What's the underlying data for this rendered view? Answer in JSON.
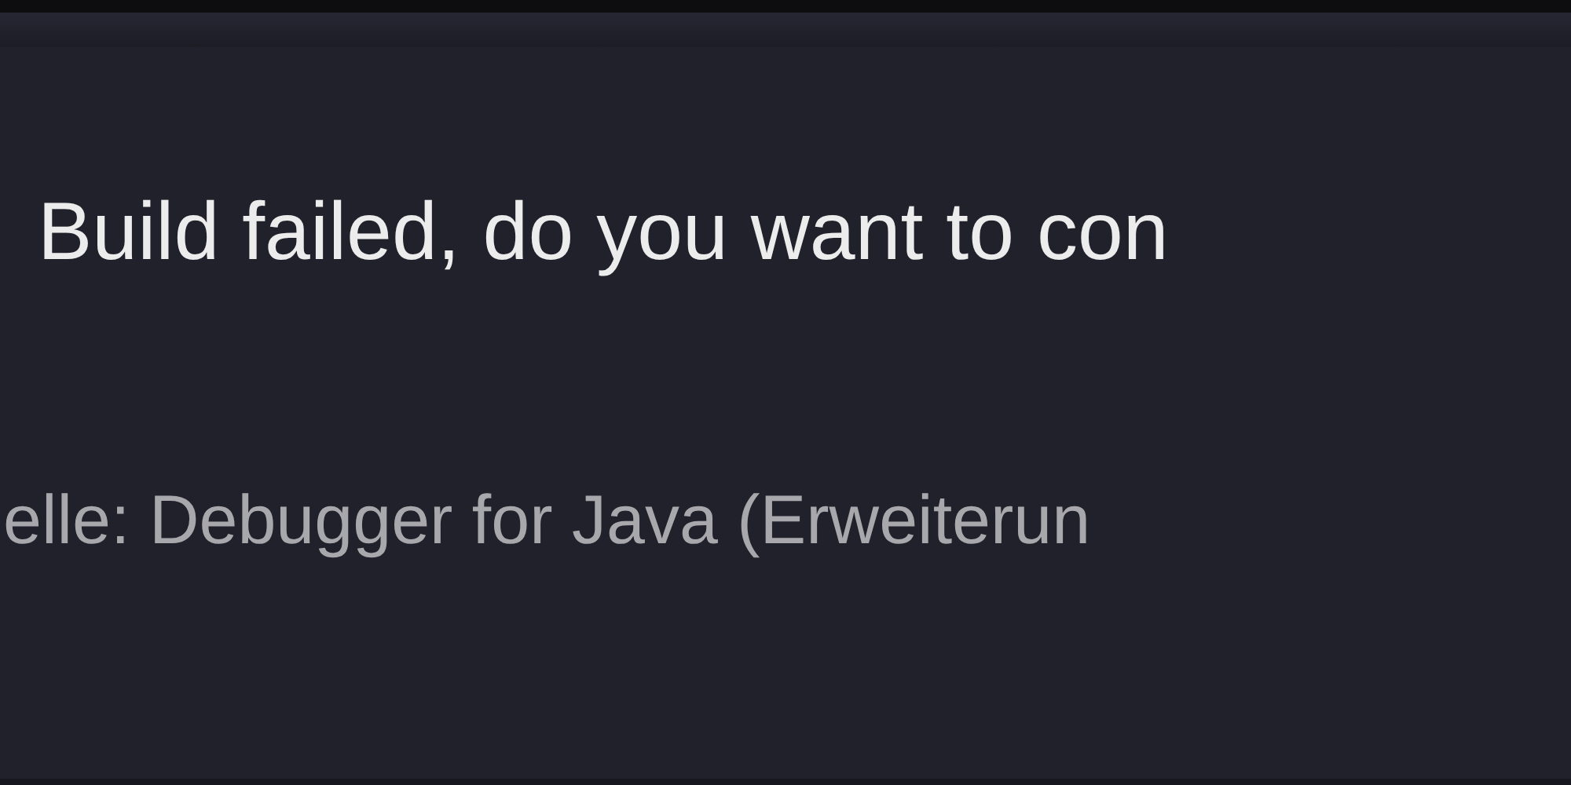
{
  "notification": {
    "message": "Build failed, do you want to con",
    "source": "elle: Debugger for Java (Erweiterun"
  }
}
